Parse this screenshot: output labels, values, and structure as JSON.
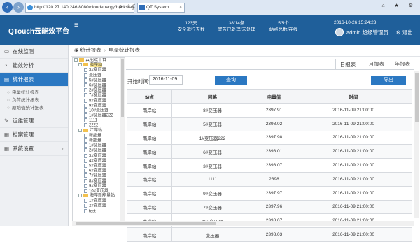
{
  "browser": {
    "url": "http://120.27.140.246:8080/cloudenergy/backstag",
    "tab_title": "QT System",
    "addr_tools": "ρ - ☆ ℭ",
    "close": "×",
    "win_ctrls": "⌂ ★ ⚙"
  },
  "header": {
    "logo": "QTouch云能效平台",
    "menu_icon": "≡",
    "stats": [
      {
        "value": "123天",
        "label": "安全运行天数"
      },
      {
        "value": "38/14条",
        "label": "警告已处理/未处理"
      },
      {
        "value": "5/5个",
        "label": "站点总数/在线"
      }
    ],
    "datetime": "2016-10-26 15:24:23",
    "user": "admin 超级管理员",
    "logout": "退出"
  },
  "sidebar": {
    "items": [
      {
        "label": "在线监测",
        "icon": "monitor-icon"
      },
      {
        "label": "能效分析",
        "icon": "chart-icon"
      },
      {
        "label": "统计报表",
        "icon": "report-icon"
      }
    ],
    "sub_items": [
      {
        "label": "电量统计报表"
      },
      {
        "label": "负荷统计报表"
      },
      {
        "label": "原始值统计报表"
      }
    ],
    "items_bottom": [
      {
        "label": "运维管理",
        "icon": "wrench-icon"
      },
      {
        "label": "档案管理",
        "icon": "archive-icon"
      },
      {
        "label": "系统设置",
        "icon": "settings-icon"
      }
    ]
  },
  "breadcrumb": {
    "root": "统计报表",
    "current": "电量统计报表"
  },
  "tree": [
    {
      "label": "云能效平台",
      "level": 0,
      "type": "folder"
    },
    {
      "label": "海岸站",
      "level": 1,
      "type": "folder",
      "selected": true
    },
    {
      "label": "3#变压器",
      "level": 2,
      "type": "file"
    },
    {
      "label": "变压器",
      "level": 2,
      "type": "file"
    },
    {
      "label": "5#变压器",
      "level": 2,
      "type": "file"
    },
    {
      "label": "6#变压器",
      "level": 2,
      "type": "file"
    },
    {
      "label": "2#变压器",
      "level": 2,
      "type": "file"
    },
    {
      "label": "7#变压器",
      "level": 2,
      "type": "file"
    },
    {
      "label": "8#变压器",
      "level": 2,
      "type": "file"
    },
    {
      "label": "9#变压器",
      "level": 2,
      "type": "file"
    },
    {
      "label": "10#变压器",
      "level": 2,
      "type": "file"
    },
    {
      "label": "1#变压器222",
      "level": 2,
      "type": "file"
    },
    {
      "label": "1111",
      "level": 2,
      "type": "file"
    },
    {
      "label": "2222",
      "level": 2,
      "type": "file"
    },
    {
      "label": "江岸站",
      "level": 1,
      "type": "folder"
    },
    {
      "label": "新能量",
      "level": 2,
      "type": "file"
    },
    {
      "label": "新能量",
      "level": 2,
      "type": "file"
    },
    {
      "label": "1#变压器",
      "level": 2,
      "type": "file"
    },
    {
      "label": "2#变压器",
      "level": 2,
      "type": "file"
    },
    {
      "label": "3#变压器",
      "level": 2,
      "type": "file"
    },
    {
      "label": "4#变压器",
      "level": 2,
      "type": "file"
    },
    {
      "label": "5#变压器",
      "level": 2,
      "type": "file"
    },
    {
      "label": "6#变压器",
      "level": 2,
      "type": "file"
    },
    {
      "label": "7#变压器",
      "level": 2,
      "type": "file"
    },
    {
      "label": "8#变压器",
      "level": 2,
      "type": "file"
    },
    {
      "label": "9#变压器",
      "level": 2,
      "type": "file"
    },
    {
      "label": "10#变压器",
      "level": 2,
      "type": "file"
    },
    {
      "label": "海岸新能量站",
      "level": 1,
      "type": "folder"
    },
    {
      "label": "1#变压器",
      "level": 2,
      "type": "file"
    },
    {
      "label": "2#变压器",
      "level": 2,
      "type": "file"
    },
    {
      "label": "test",
      "level": 2,
      "type": "file"
    }
  ],
  "period_tabs": [
    {
      "label": "日报表",
      "active": true
    },
    {
      "label": "月报表",
      "active": false
    },
    {
      "label": "年报表",
      "active": false
    }
  ],
  "filter": {
    "label": "开始时间:",
    "date": "2016-11-09",
    "query_button": "查询",
    "export_button": "导出"
  },
  "table": {
    "columns": [
      "站点",
      "回路",
      "电量值",
      "时间"
    ],
    "rows": [
      [
        "南岸站",
        "8#变压器",
        "2397.91",
        "2016-11-09 21:00:00"
      ],
      [
        "南岸站",
        "5#变压器",
        "2398.02",
        "2016-11-09 21:00:00"
      ],
      [
        "南岸站",
        "1#变压器222",
        "2397.98",
        "2016-11-09 21:00:00"
      ],
      [
        "南岸站",
        "6#变压器",
        "2398.01",
        "2016-11-09 21:00:00"
      ],
      [
        "南岸站",
        "3#变压器",
        "2398.07",
        "2016-11-09 21:00:00"
      ],
      [
        "南岸站",
        "1111",
        "2398",
        "2016-11-09 21:00:00"
      ],
      [
        "南岸站",
        "9#变压器",
        "2397.97",
        "2016-11-09 21:00:00"
      ],
      [
        "南岸站",
        "7#变压器",
        "2397.96",
        "2016-11-09 21:00:00"
      ],
      [
        "南岸站",
        "10#变压器",
        "2398.07",
        "2016-11-09 21:00:00"
      ],
      [
        "南岸站",
        "变压器",
        "2398.03",
        "2016-11-09 21:00:00"
      ]
    ]
  }
}
